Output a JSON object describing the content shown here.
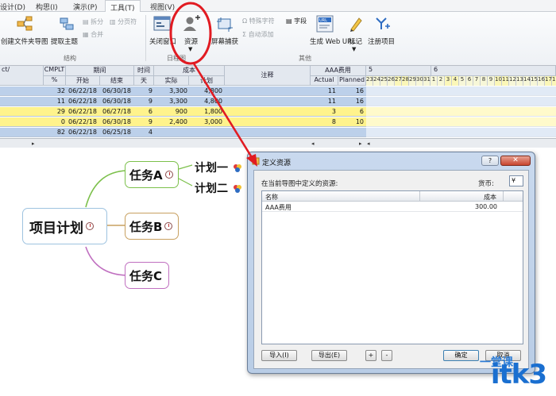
{
  "ribbon": {
    "tabs": [
      "设计(D)",
      "构思(I)",
      "演示(P)",
      "工具(T)",
      "视图(V)"
    ],
    "active_tab": "工具(T)",
    "buttons": {
      "new_folder_map": "创建文件夹导图",
      "extract_topic": "提取主题",
      "split": "拆分",
      "merge": "合并",
      "paging": "分页符",
      "close_window": "关闭窗口",
      "resource": "资源",
      "screen_capture": "屏幕捕获",
      "special_char": "特殊字符",
      "auto_add": "自动添加",
      "field": "字段",
      "generate_web_url": "生成 Web URL",
      "mark": "标记",
      "register_item": "注册项目"
    },
    "groups": {
      "structure": "结构",
      "schedule": "日程图",
      "other": "其他"
    }
  },
  "sheet": {
    "headers": {
      "c1": "ct/",
      "cmplt": "CMPLT",
      "cmplt_unit": "%",
      "period": "期间",
      "start": "开始",
      "end": "结束",
      "time": "时间",
      "days": "天",
      "cost_group": "成本",
      "actual": "实际",
      "plan": "计划",
      "notes": "注释",
      "aaa_cost": "AAA费用",
      "actual_en": "Actual",
      "planned_en": "Planned",
      "week5": "5",
      "week6": "6"
    },
    "days": [
      "23",
      "24",
      "25",
      "26",
      "27",
      "28",
      "29",
      "30",
      "31",
      "1",
      "2",
      "3",
      "4",
      "5",
      "6",
      "7",
      "8",
      "9",
      "10",
      "11",
      "12",
      "13",
      "14",
      "15",
      "16",
      "17",
      "18"
    ],
    "rows": [
      {
        "cmplt": "32",
        "start": "06/22/18",
        "end": "06/30/18",
        "days": "9",
        "actual": "3,300",
        "plan": "4,800",
        "aaa_actual": "11",
        "aaa_planned": "16",
        "color": "#bcd0ea"
      },
      {
        "cmplt": "11",
        "start": "06/22/18",
        "end": "06/30/18",
        "days": "9",
        "actual": "3,300",
        "plan": "4,800",
        "aaa_actual": "11",
        "aaa_planned": "16",
        "color": "#bcd0ea"
      },
      {
        "cmplt": "29",
        "start": "06/22/18",
        "end": "06/27/18",
        "days": "6",
        "actual": "900",
        "plan": "1,800",
        "aaa_actual": "3",
        "aaa_planned": "6",
        "color": "#fff38c"
      },
      {
        "cmplt": "0",
        "start": "06/22/18",
        "end": "06/30/18",
        "days": "9",
        "actual": "2,400",
        "plan": "3,000",
        "aaa_actual": "8",
        "aaa_planned": "10",
        "color": "#fff38c"
      },
      {
        "cmplt": "82",
        "start": "06/22/18",
        "end": "06/25/18",
        "days": "4",
        "actual": "",
        "plan": "",
        "aaa_actual": "",
        "aaa_planned": "",
        "color": "#bcd0ea"
      }
    ]
  },
  "mindmap": {
    "root": "项目计划",
    "task_a": "任务A",
    "task_b": "任务B",
    "task_c": "任务C",
    "plan_1": "计划一",
    "plan_2": "计划二"
  },
  "dialog": {
    "title": "定义资源",
    "help": "?",
    "prompt": "在当前导图中定义的资源:",
    "currency_label": "货币:",
    "currency_value": "¥",
    "col_name": "名称",
    "col_cost": "成本",
    "resource_name": "AAA费用",
    "resource_cost": "300.00",
    "import": "导入(I)",
    "export": "导出(E)",
    "plus": "+",
    "minus": "-",
    "ok": "确定",
    "cancel": "取消"
  },
  "watermark": {
    "brand": "itk3",
    "cn": "一堂课"
  },
  "colors": {
    "highlight_ring": "#e11b22",
    "arrow": "#e11b22",
    "branch_a": "#7cc04b",
    "branch_b": "#c8a060",
    "branch_c": "#c070c0",
    "watermark": "#1a6fd0"
  }
}
